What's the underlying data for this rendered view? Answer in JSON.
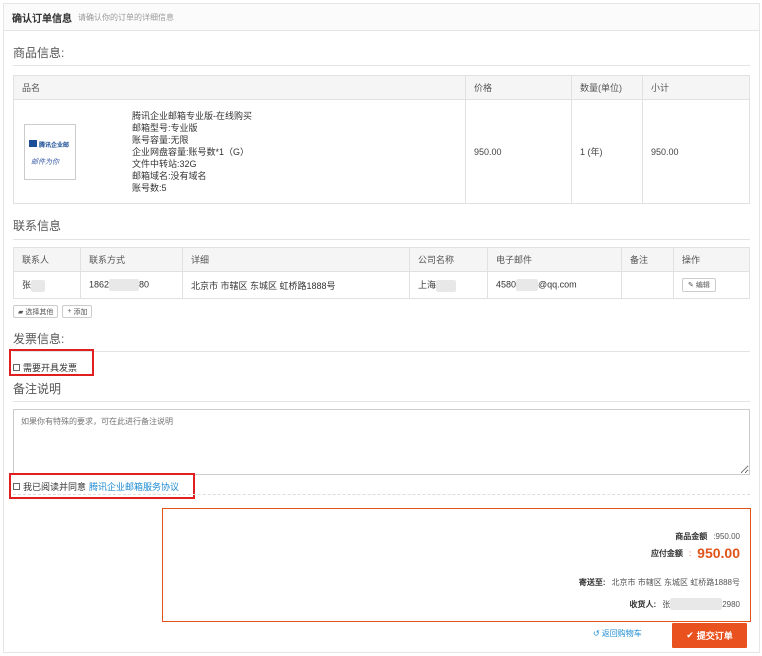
{
  "header": {
    "title": "确认订单信息",
    "subtitle": "请确认你的订单的详细信息"
  },
  "product_section": {
    "title": "商品信息:",
    "columns": [
      "品名",
      "价格",
      "数量(单位)",
      "小计"
    ],
    "item": {
      "image_label": "腾讯企业邮",
      "image_signature": "邮件为你",
      "lines": [
        "腾讯企业邮箱专业版-在线购买",
        "邮箱型号:专业版",
        "账号容量:无限",
        "企业网盘容量:账号数*1（G）",
        "文件中转站:32G",
        "邮箱域名:没有域名",
        "账号数:5"
      ],
      "price": "950.00",
      "quantity": "1 (年)",
      "subtotal": "950.00"
    }
  },
  "contact_section": {
    "title": "联系信息",
    "columns": [
      "联系人",
      "联系方式",
      "详细",
      "公司名称",
      "电子邮件",
      "备注",
      "操作"
    ],
    "row": {
      "name": "张",
      "phone_start": "1862",
      "phone_end": "80",
      "address": "北京市 市辖区 东城区 虹桥路1888号",
      "company": "上海",
      "email_start": "4580",
      "email_end": "@qq.com",
      "note": "",
      "edit_label": "编辑"
    },
    "select_other_label": "选择其他",
    "add_label": "添加"
  },
  "invoice_section": {
    "title": "发票信息:",
    "checkbox_label": "需要开具发票"
  },
  "remark_section": {
    "title": "备注说明",
    "placeholder": "如果你有特殊的要求，可在此进行备注说明"
  },
  "agreement": {
    "prefix": "我已阅读并同意",
    "link_text": "腾讯企业邮箱服务协议"
  },
  "summary": {
    "goods_amount_label": "商品金额",
    "goods_amount": ":950.00",
    "payable_label": "应付金额",
    "payable_colon": ":",
    "payable_amount": "950.00",
    "ship_to_label": "寄送至:",
    "ship_to_value": "北京市 市辖区 东城区 虹桥路1888号",
    "receiver_label": "收货人:",
    "receiver_start": "张",
    "receiver_end": "2980"
  },
  "actions": {
    "back_label": "返回购物车",
    "submit_label": "提交订单"
  },
  "colors": {
    "accent": "#e9521e",
    "link": "#1b8ad1",
    "highlight_box": "#e02020"
  }
}
